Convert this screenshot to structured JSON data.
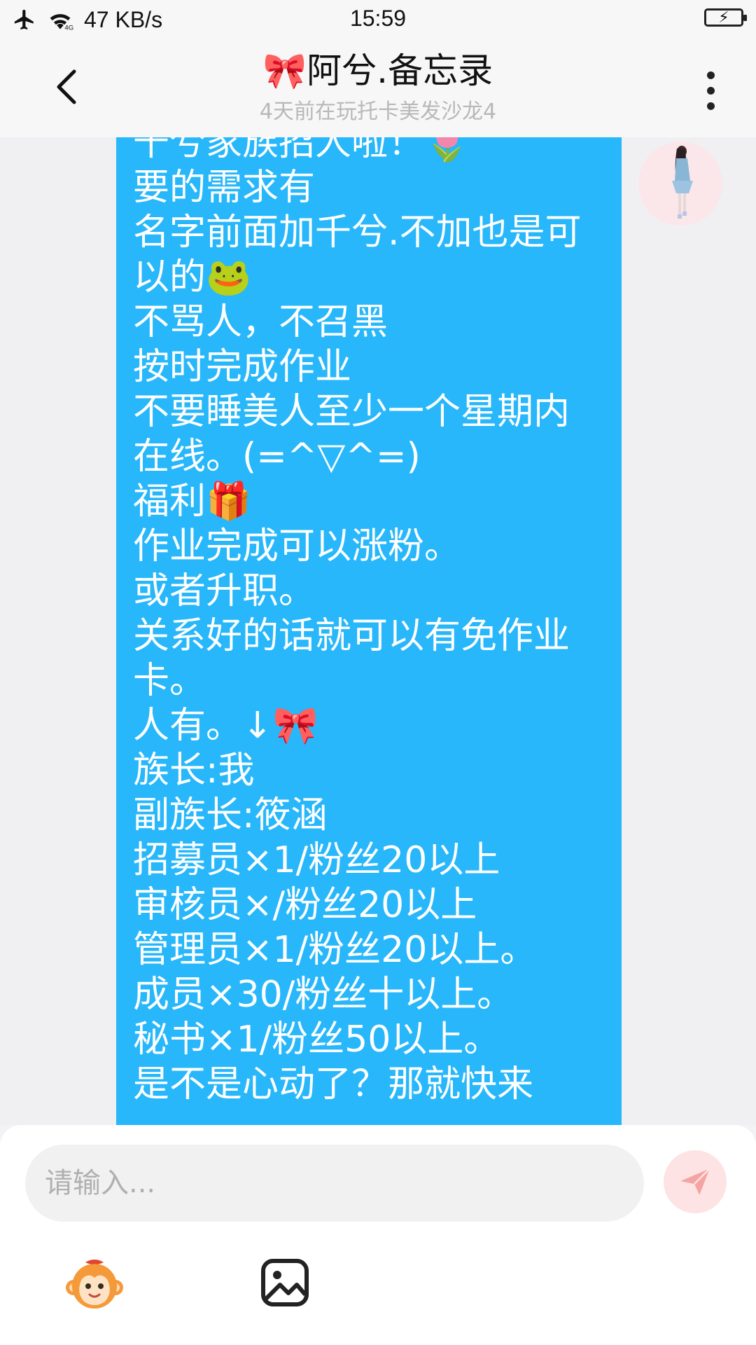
{
  "status_bar": {
    "network_speed": "47 KB/s",
    "time": "15:59"
  },
  "header": {
    "title": "🎀阿兮.备忘录",
    "subtitle": "4天前在玩托卡美发沙龙4"
  },
  "message": {
    "text": "千兮家族招人啦！🌷\n要的需求有\n名字前面加千兮.不加也是可以的🐸\n不骂人，不召黑\n按时完成作业\n不要睡美人至少一个星期内在线。(=^▽^=)\n福利🎁\n作业完成可以涨粉。\n或者升职。\n关系好的话就可以有免作业卡。\n人有。↓🎀\n族长:我\n副族长:筱涵\n招募员×1/粉丝20以上\n审核员×/粉丝20以上\n管理员×1/粉丝20以上。\n成员×30/粉丝十以上。\n秘书×1/粉丝50以上。\n是不是心动了？那就快来"
  },
  "input": {
    "placeholder": "请输入..."
  },
  "icons": {
    "back": "back-arrow-icon",
    "more": "more-vertical-icon",
    "send": "paper-plane-icon",
    "emoji": "monkey-emoji-icon",
    "image": "image-icon",
    "wifi": "wifi-icon",
    "airplane": "airplane-icon",
    "battery": "battery-charging-icon"
  },
  "colors": {
    "bubble": "#27b7fa",
    "send_bg": "#fde3e3",
    "send_icon": "#f6a3a3"
  }
}
